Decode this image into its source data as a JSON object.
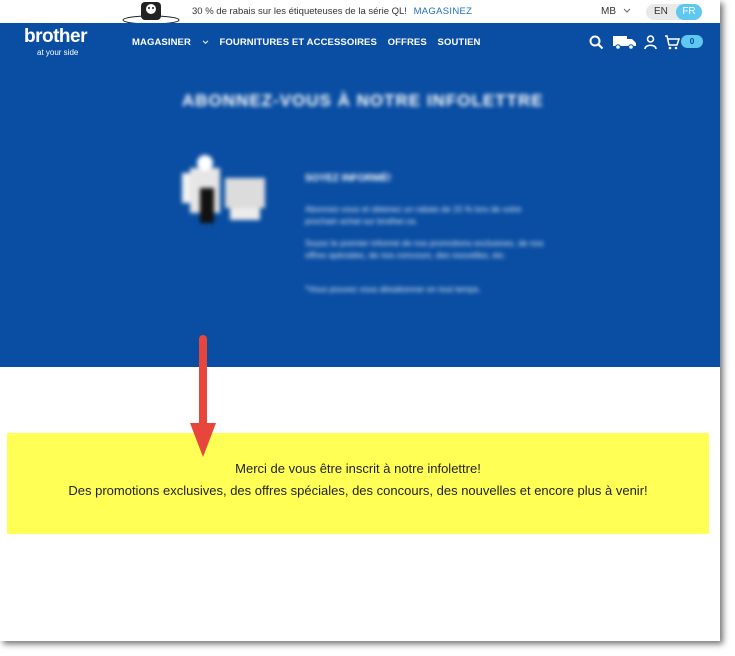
{
  "promo": {
    "text": "30 % de rabais sur les étiqueteuses de la série QL!",
    "link": "MAGASINEZ",
    "region": "MB",
    "lang_en": "EN",
    "lang_fr": "FR"
  },
  "nav": {
    "logo_word": "brother",
    "logo_tag": "at your side",
    "items": [
      "MAGASINER",
      "FOURNITURES ET ACCESSOIRES",
      "OFFRES",
      "SOUTIEN"
    ],
    "cart_count": "0"
  },
  "hero": {
    "title": "ABONNEZ-VOUS À NOTRE INFOLETTRE",
    "subtitle": "SOYEZ INFORMÉ!",
    "para1": "Abonnez-vous et obtenez un rabais de 15 % lors de votre prochain achat sur brother.ca.",
    "para2": "Soyez le premier informé de nos promotions exclusives, de nos offres spéciales, de nos concours, des nouvelles, etc.",
    "para3": "*Vous pouvez vous désabonner en tout temps."
  },
  "confirm": {
    "line1": "Merci de vous être inscrit à notre infolettre!",
    "line2": "Des promotions exclusives, des offres spéciales, des concours, des nouvelles et encore plus à venir!"
  },
  "colors": {
    "brand": "#0a4ea3",
    "accent": "#5ec8f0",
    "highlight": "#ffff55",
    "arrow": "#e8453c"
  },
  "icons": [
    "mascot-icon",
    "chevron-down-icon",
    "search-icon",
    "delivery-truck-icon",
    "user-icon",
    "cart-icon",
    "arrow-annotation-icon"
  ]
}
